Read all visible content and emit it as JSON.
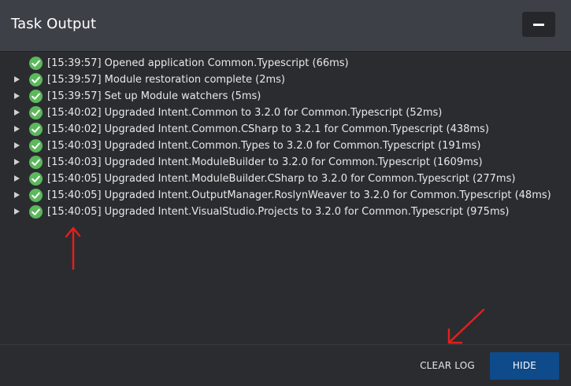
{
  "window": {
    "title": "Task Output"
  },
  "log": {
    "entries": [
      {
        "text": "[15:39:57] Opened application Common.Typescript (66ms)",
        "expandable": false,
        "status": "success"
      },
      {
        "text": "[15:39:57] Module restoration complete (2ms)",
        "expandable": true,
        "status": "success"
      },
      {
        "text": "[15:39:57] Set up Module watchers (5ms)",
        "expandable": true,
        "status": "success"
      },
      {
        "text": "[15:40:02] Upgraded Intent.Common to 3.2.0 for Common.Typescript (52ms)",
        "expandable": true,
        "status": "success"
      },
      {
        "text": "[15:40:02] Upgraded Intent.Common.CSharp to 3.2.1 for Common.Typescript (438ms)",
        "expandable": true,
        "status": "success"
      },
      {
        "text": "[15:40:03] Upgraded Intent.Common.Types to 3.2.0 for Common.Typescript (191ms)",
        "expandable": true,
        "status": "success"
      },
      {
        "text": "[15:40:03] Upgraded Intent.ModuleBuilder to 3.2.0 for Common.Typescript (1609ms)",
        "expandable": true,
        "status": "success"
      },
      {
        "text": "[15:40:05] Upgraded Intent.ModuleBuilder.CSharp to 3.2.0 for Common.Typescript (277ms)",
        "expandable": true,
        "status": "success"
      },
      {
        "text": "[15:40:05] Upgraded Intent.OutputManager.RoslynWeaver to 3.2.0 for Common.Typescript (48ms)",
        "expandable": true,
        "status": "success"
      },
      {
        "text": "[15:40:05] Upgraded Intent.VisualStudio.Projects to 3.2.0 for Common.Typescript (975ms)",
        "expandable": true,
        "status": "success"
      }
    ]
  },
  "footer": {
    "clear_label": "CLEAR LOG",
    "hide_label": "HIDE"
  },
  "colors": {
    "titlebar": "#3d4147",
    "body": "#2b2c30",
    "success": "#5cb85c",
    "primary_button": "#0f4a8a",
    "annotation": "#e0201c"
  },
  "icons": {
    "minimize": "minimize-icon",
    "expander": "caret-right-icon",
    "status": "check-circle-icon"
  }
}
